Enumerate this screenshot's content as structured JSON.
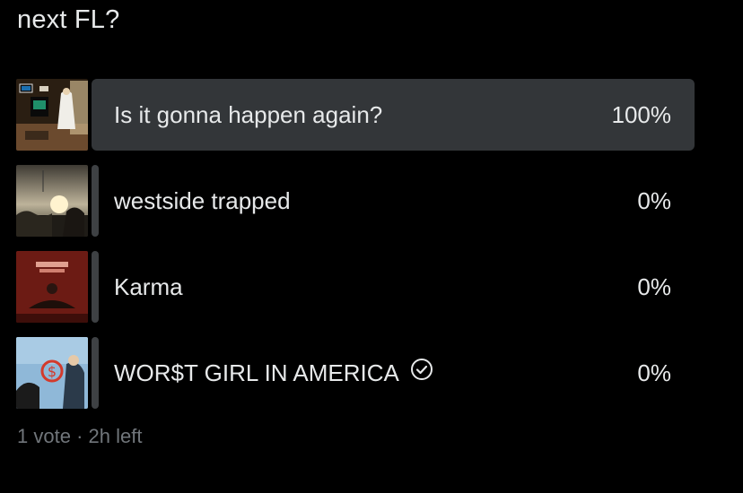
{
  "poll": {
    "question": "next FL?",
    "options": [
      {
        "label": "Is it gonna happen again?",
        "percent_text": "100%",
        "percent": 100,
        "thumbnail_icon": "performer-stage-thumbnail"
      },
      {
        "label": "westside trapped",
        "percent_text": "0%",
        "percent": 0,
        "thumbnail_icon": "sunset-field-thumbnail"
      },
      {
        "label": "Karma",
        "percent_text": "0%",
        "percent": 0,
        "thumbnail_icon": "red-album-cover-thumbnail"
      },
      {
        "label": "WOR$T GIRL IN AMERICA",
        "percent_text": "0%",
        "percent": 0,
        "thumbnail_icon": "blue-album-cover-thumbnail",
        "selected_icon": "check-circle-icon"
      }
    ],
    "vote_count": "1 vote",
    "separator": "·",
    "time_left": "2h left"
  },
  "colors": {
    "background": "#000000",
    "text": "#e7e9ea",
    "muted": "#71767b",
    "winning_bar": "#333639",
    "empty_bar": "#3e4144"
  }
}
